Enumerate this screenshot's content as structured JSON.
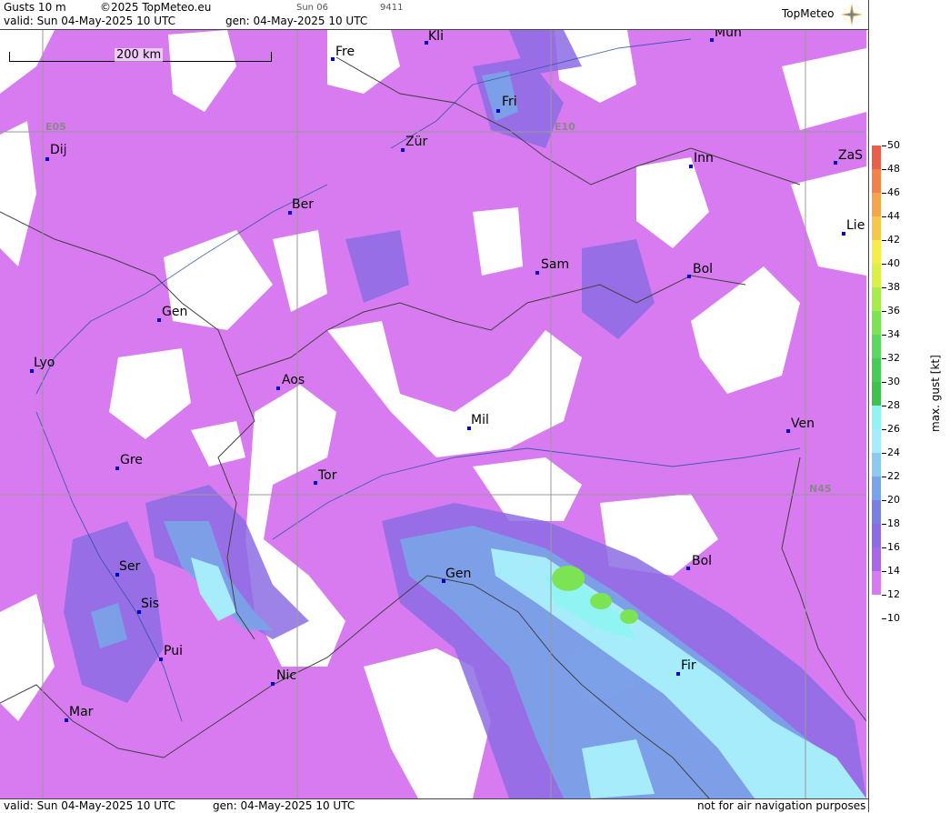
{
  "header": {
    "product": "Gusts 10 m",
    "copyright": "©2025 TopMeteo.eu",
    "valid": "valid:  Sun  04-May-2025  10 UTC",
    "gen": "gen: 04-May-2025 10 UTC",
    "day_code": "Sun 06",
    "id_code": "9411",
    "logo": "TopMeteo"
  },
  "footer": {
    "valid": "valid:  Sun  04-May-2025  10 UTC",
    "gen": "gen: 04-May-2025 10 UTC",
    "note": "not for air navigation purposes"
  },
  "map": {
    "scale_label": "200 km",
    "grid_labels": [
      "E05",
      "E10",
      "N45"
    ],
    "cities": [
      {
        "name": "Kli"
      },
      {
        "name": "Mun"
      },
      {
        "name": "Fre"
      },
      {
        "name": "Fri"
      },
      {
        "name": "Dij"
      },
      {
        "name": "Zür"
      },
      {
        "name": "Inn"
      },
      {
        "name": "ZaS"
      },
      {
        "name": "Ber"
      },
      {
        "name": "Lie"
      },
      {
        "name": "Sam"
      },
      {
        "name": "Bol"
      },
      {
        "name": "Gen"
      },
      {
        "name": "Lyo"
      },
      {
        "name": "Aos"
      },
      {
        "name": "Mil"
      },
      {
        "name": "Ven"
      },
      {
        "name": "Gre"
      },
      {
        "name": "Tor"
      },
      {
        "name": "Ser"
      },
      {
        "name": "Gen"
      },
      {
        "name": "Bol"
      },
      {
        "name": "Sis"
      },
      {
        "name": "Pui"
      },
      {
        "name": "Nic"
      },
      {
        "name": "Fir"
      },
      {
        "name": "Mar"
      }
    ]
  },
  "legend": {
    "title": "max. gust [kt]",
    "ticks": [
      "50",
      "48",
      "46",
      "44",
      "42",
      "40",
      "38",
      "36",
      "34",
      "32",
      "30",
      "28",
      "26",
      "24",
      "22",
      "20",
      "18",
      "16",
      "14",
      "12",
      "10"
    ],
    "colors": [
      "#e8604c",
      "#f08448",
      "#f4a64a",
      "#f6c84a",
      "#f6ec4a",
      "#d8f048",
      "#a8ec4a",
      "#7ce454",
      "#5cd860",
      "#48cc58",
      "#40c04c",
      "#90f4f2",
      "#a6ecfa",
      "#8ecaf0",
      "#7aa4e8",
      "#7a80e0",
      "#8c6ce4",
      "#a868e8",
      "#d87af0",
      "#ffffff"
    ]
  }
}
